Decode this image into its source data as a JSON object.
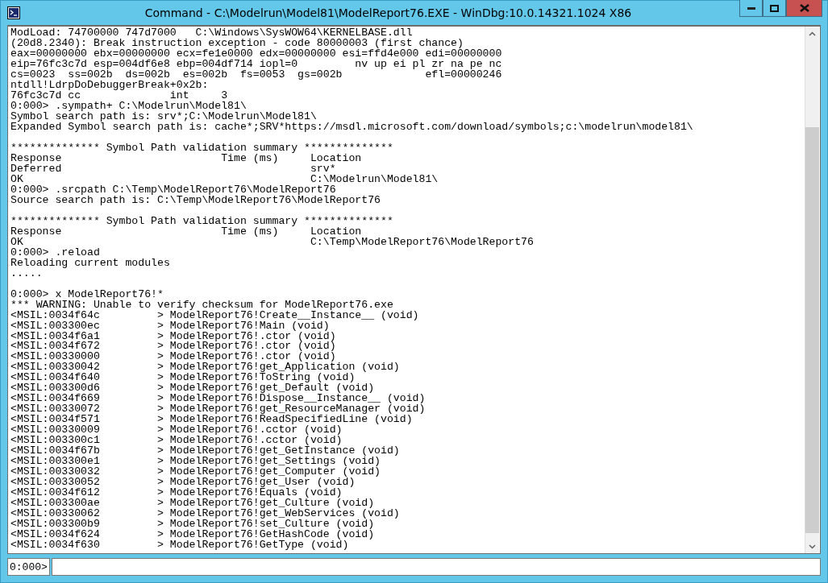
{
  "window": {
    "title": "Command - C:\\Modelrun\\Model81\\ModelReport76.EXE - WinDbg:10.0.14321.1024 X86"
  },
  "output": {
    "blocks": [
      [
        "ModLoad: 74700000 747d7000   C:\\Windows\\SysWOW64\\KERNELBASE.dll",
        "(20d8.2340): Break instruction exception - code 80000003 (first chance)",
        "eax=00000000 ebx=00000000 ecx=fe1e0000 edx=00000000 esi=ffd4e000 edi=00000000",
        "eip=76fc3c7d esp=004df6e8 ebp=004df714 iopl=0         nv up ei pl zr na pe nc",
        "cs=0023  ss=002b  ds=002b  es=002b  fs=0053  gs=002b             efl=00000246",
        "ntdll!LdrpDoDebuggerBreak+0x2b:",
        "76fc3c7d cc              int     3",
        "0:000> .sympath+ C:\\Modelrun\\Model81\\",
        "Symbol search path is: srv*;C:\\Modelrun\\Model81\\",
        "Expanded Symbol search path is: cache*;SRV*https://msdl.microsoft.com/download/symbols;c:\\modelrun\\model81\\"
      ],
      [
        "************** Symbol Path validation summary **************",
        "Response                         Time (ms)     Location",
        "Deferred                                       srv*",
        "OK                                             C:\\Modelrun\\Model81\\",
        "0:000> .srcpath C:\\Temp\\ModelReport76\\ModelReport76",
        "Source search path is: C:\\Temp\\ModelReport76\\ModelReport76"
      ],
      [
        "************** Symbol Path validation summary **************",
        "Response                         Time (ms)     Location",
        "OK                                             C:\\Temp\\ModelReport76\\ModelReport76",
        "0:000> .reload",
        "Reloading current modules",
        "....."
      ],
      [
        "0:000> x ModelReport76!*",
        "*** WARNING: Unable to verify checksum for ModelReport76.exe",
        "<MSIL:0034f64c         > ModelReport76!Create__Instance__ (void)",
        "<MSIL:003300ec         > ModelReport76!Main (void)",
        "<MSIL:0034f6a1         > ModelReport76!.ctor (void)",
        "<MSIL:0034f672         > ModelReport76!.ctor (void)",
        "<MSIL:00330000         > ModelReport76!.ctor (void)",
        "<MSIL:00330042         > ModelReport76!get_Application (void)",
        "<MSIL:0034f640         > ModelReport76!ToString (void)",
        "<MSIL:003300d6         > ModelReport76!get_Default (void)",
        "<MSIL:0034f669         > ModelReport76!Dispose__Instance__ (void)",
        "<MSIL:00330072         > ModelReport76!get_ResourceManager (void)",
        "<MSIL:0034f571         > ModelReport76!ReadSpecifiedLine (void)",
        "<MSIL:00330009         > ModelReport76!.cctor (void)",
        "<MSIL:003300c1         > ModelReport76!.cctor (void)",
        "<MSIL:0034f67b         > ModelReport76!get_GetInstance (void)",
        "<MSIL:003300e1         > ModelReport76!get_Settings (void)",
        "<MSIL:00330032         > ModelReport76!get_Computer (void)",
        "<MSIL:00330052         > ModelReport76!get_User (void)",
        "<MSIL:0034f612         > ModelReport76!Equals (void)",
        "<MSIL:003300ae         > ModelReport76!get_Culture (void)",
        "<MSIL:00330062         > ModelReport76!get_WebServices (void)",
        "<MSIL:003300b9         > ModelReport76!set_Culture (void)",
        "<MSIL:0034f624         > ModelReport76!GetHashCode (void)",
        "<MSIL:0034f630         > ModelReport76!GetType (void)"
      ]
    ]
  },
  "command": {
    "prompt": "0:000>"
  }
}
